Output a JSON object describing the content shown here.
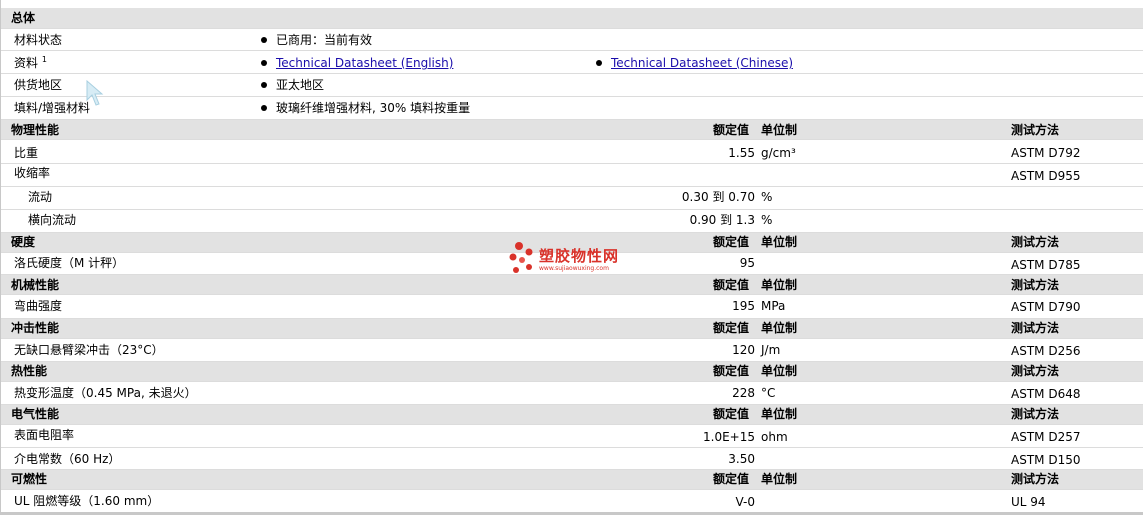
{
  "sections": {
    "general": {
      "title": "总体",
      "rows": [
        {
          "label": "材料状态",
          "bullets": [
            "已商用：当前有效"
          ]
        },
        {
          "label": "资料",
          "footnote": "1",
          "links": [
            "Technical Datasheet (English)",
            "Technical Datasheet (Chinese)"
          ]
        },
        {
          "label": "供货地区",
          "bullets": [
            "亚太地区"
          ]
        },
        {
          "label": "填料/增强材料",
          "bullets": [
            "玻璃纤维增强材料, 30% 填料按重量"
          ]
        }
      ]
    },
    "columns": {
      "value": "额定值",
      "unit": "单位制",
      "method": "测试方法"
    },
    "physical": {
      "title": "物理性能",
      "rows": [
        {
          "label": "比重",
          "value": "1.55",
          "unit": "g/cm³",
          "method": "ASTM D792"
        },
        {
          "label": "收缩率",
          "value": "",
          "unit": "",
          "method": "ASTM D955"
        },
        {
          "label": "流动",
          "value": "0.30 到  0.70",
          "unit": "%",
          "method": ""
        },
        {
          "label": "横向流动",
          "value": "0.90 到  1.3",
          "unit": "%",
          "method": ""
        }
      ]
    },
    "hardness": {
      "title": "硬度",
      "rows": [
        {
          "label": "洛氏硬度（M 计秤）",
          "value": "95",
          "unit": "",
          "method": "ASTM D785"
        }
      ]
    },
    "mechanical": {
      "title": "机械性能",
      "rows": [
        {
          "label": "弯曲强度",
          "value": "195",
          "unit": "MPa",
          "method": "ASTM D790"
        }
      ]
    },
    "impact": {
      "title": "冲击性能",
      "rows": [
        {
          "label": "无缺口悬臂梁冲击（23°C）",
          "value": "120",
          "unit": "J/m",
          "method": "ASTM D256"
        }
      ]
    },
    "thermal": {
      "title": "热性能",
      "rows": [
        {
          "label": "热变形温度（0.45 MPa, 未退火）",
          "value": "228",
          "unit": "°C",
          "method": "ASTM D648"
        }
      ]
    },
    "electrical": {
      "title": "电气性能",
      "rows": [
        {
          "label": "表面电阻率",
          "value": "1.0E+15",
          "unit": "ohm",
          "method": "ASTM D257"
        },
        {
          "label": "介电常数（60 Hz）",
          "value": "3.50",
          "unit": "",
          "method": "ASTM D150"
        }
      ]
    },
    "flammability": {
      "title": "可燃性",
      "rows": [
        {
          "label": "UL 阻燃等级（1.60 mm）",
          "value": "V-0",
          "unit": "",
          "method": "UL 94"
        }
      ]
    }
  },
  "watermark": {
    "text": "塑胶物性网",
    "url": "www.sujiaowuxing.com"
  },
  "colors": {
    "header_bg": "#e2e2e2",
    "link": "#1a0dab",
    "watermark": "#d9322a"
  }
}
